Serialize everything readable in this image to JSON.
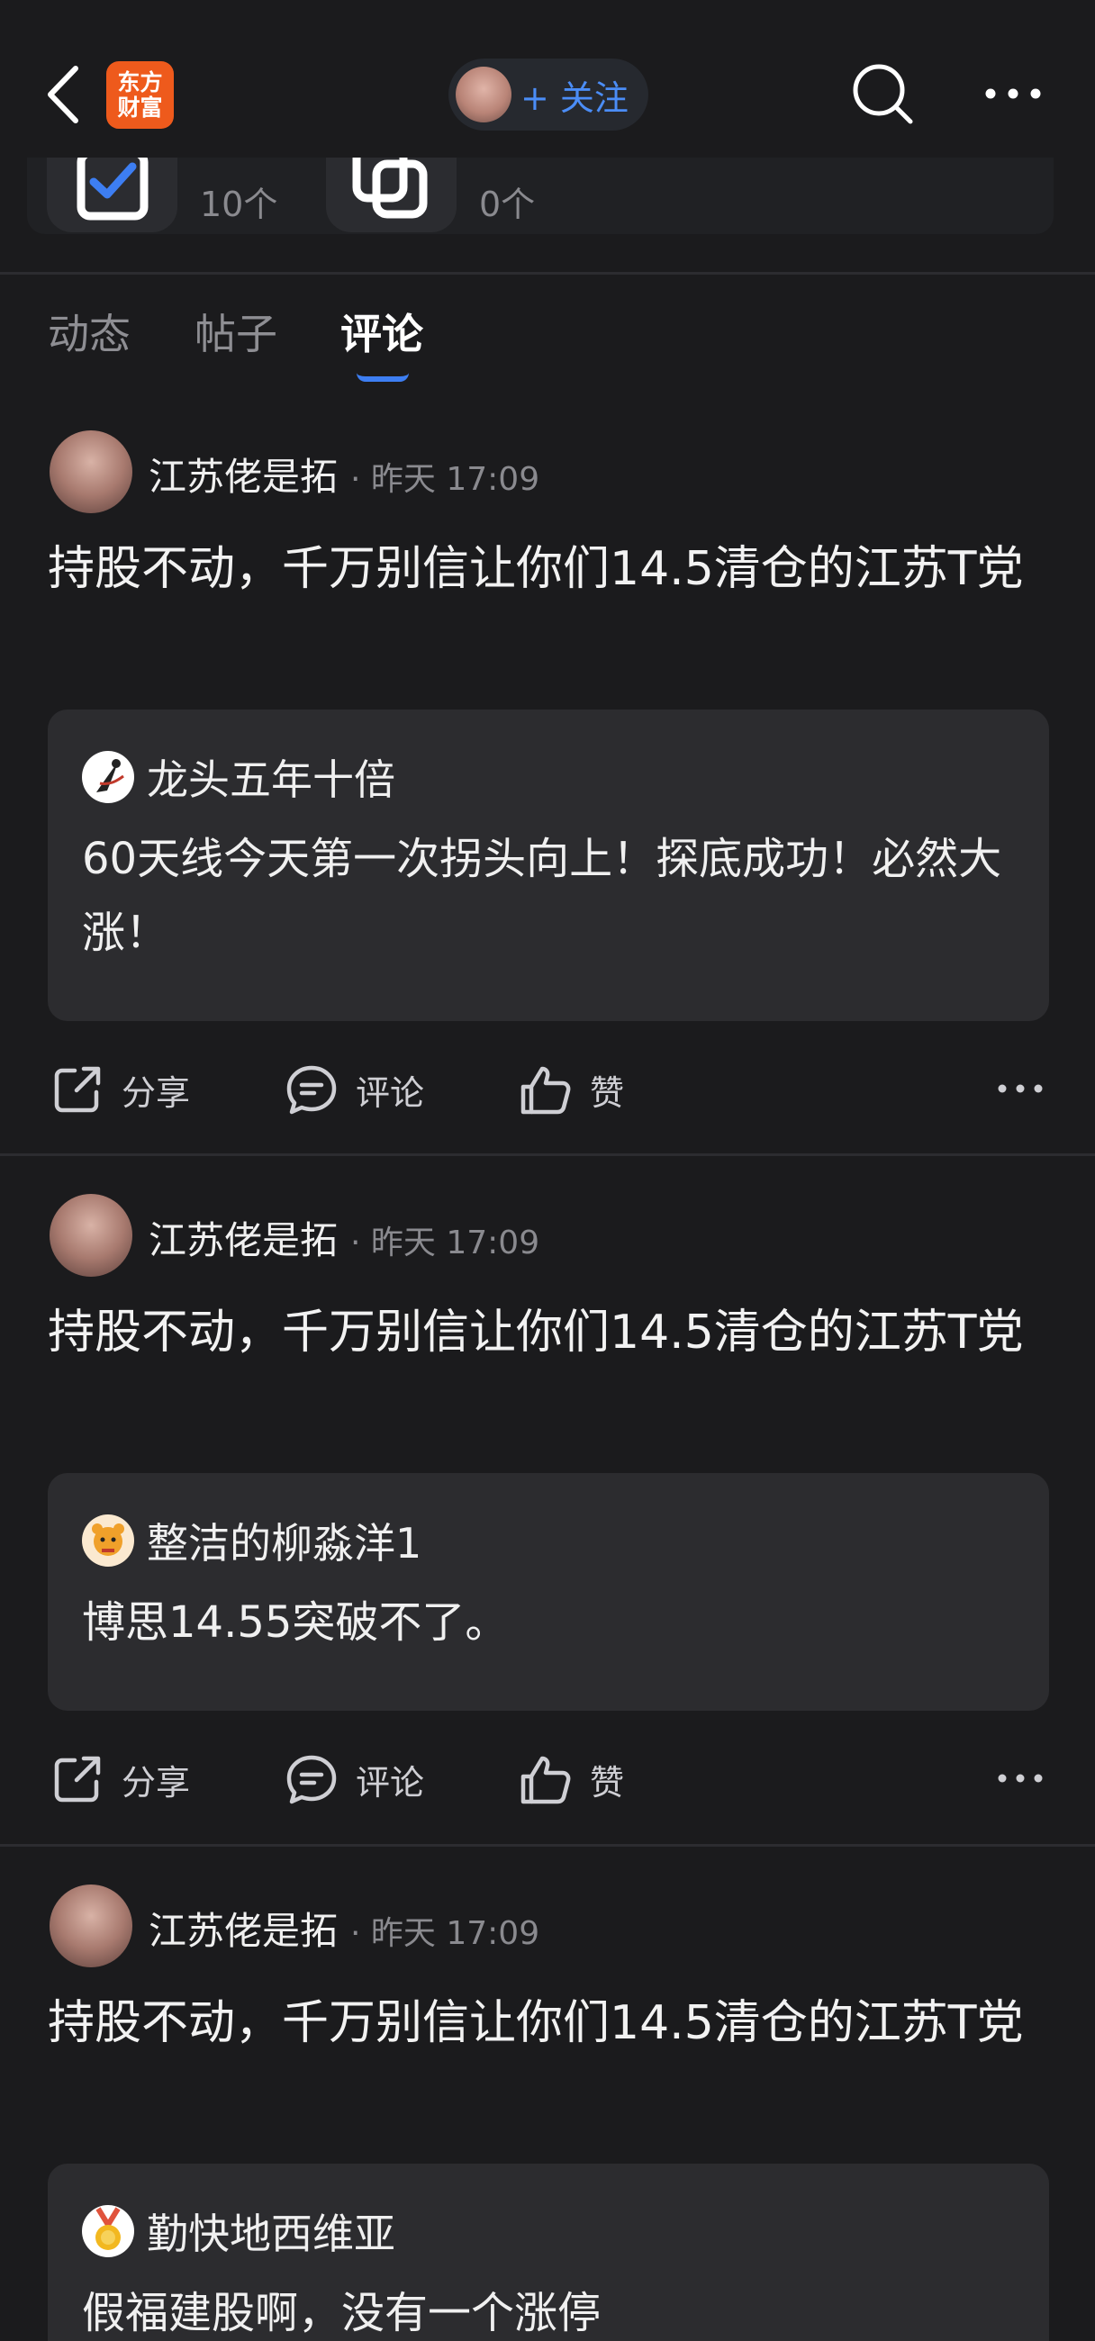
{
  "header": {
    "app_logo_line1": "东方",
    "app_logo_line2": "财富",
    "follow_label": "+ 关注"
  },
  "stats": [
    {
      "count": "10个",
      "icon": "checkbox-icon"
    },
    {
      "count": "0个",
      "icon": "copy-icon"
    }
  ],
  "tabs": [
    {
      "label": "动态",
      "active": false
    },
    {
      "label": "帖子",
      "active": false
    },
    {
      "label": "评论",
      "active": true
    }
  ],
  "actions": {
    "share": "分享",
    "comment": "评论",
    "like": "赞"
  },
  "comments": [
    {
      "author": "江苏佬是拓",
      "time": "· 昨天 17:09",
      "text": "持股不动，千万别信让你们14.5清仓的江苏T党",
      "quote": {
        "author": "龙头五年十倍",
        "text": "60天线今天第一次拐头向上！探底成功！必然大涨！"
      }
    },
    {
      "author": "江苏佬是拓",
      "time": "· 昨天 17:09",
      "text": "持股不动，千万别信让你们14.5清仓的江苏T党",
      "quote": {
        "author": "整洁的柳淼洋1",
        "text": "博思14.55突破不了。"
      }
    },
    {
      "author": "江苏佬是拓",
      "time": "· 昨天 17:09",
      "text": "持股不动，千万别信让你们14.5清仓的江苏T党",
      "quote": {
        "author": "勤快地西维亚",
        "text": "假福建股啊，没有一个涨停"
      }
    }
  ],
  "colors": {
    "background": "#1b1b1d",
    "accent_blue": "#4b8df7",
    "logo_orange": "#ee5a1c",
    "quote_bg": "#2c2c2f"
  }
}
